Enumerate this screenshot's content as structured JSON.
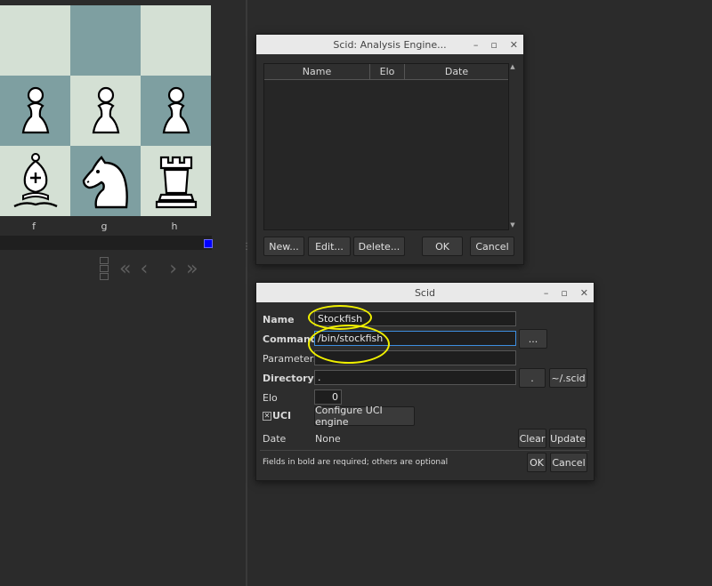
{
  "board": {
    "files": [
      "f",
      "g",
      "h"
    ],
    "pieces": {
      "pawn": "pawn-icon",
      "bishop": "bishop-icon",
      "knight": "knight-icon",
      "rook": "rook-icon"
    }
  },
  "engine_list_window": {
    "title": "Scid: Analysis Engine...",
    "columns": [
      "Name",
      "Elo",
      "Date"
    ],
    "buttons": {
      "new": "New...",
      "edit": "Edit...",
      "delete": "Delete...",
      "ok": "OK",
      "cancel": "Cancel"
    }
  },
  "engine_config_window": {
    "title": "Scid",
    "fields": {
      "name_label": "Name",
      "name_value": "Stockfish",
      "command_label": "Command",
      "command_value": "/bin/stockfish",
      "parameters_label": "Parameters",
      "parameters_value": "",
      "directory_label": "Directory",
      "directory_value": ".",
      "elo_label": "Elo",
      "elo_value": "0",
      "uci_label": "UCI",
      "date_label": "Date",
      "date_value": "None"
    },
    "buttons": {
      "browse": "...",
      "dir_dot": ".",
      "dir_home": "~/.scid",
      "configure_uci": "Configure UCI engine",
      "clear": "Clear",
      "update": "Update",
      "ok": "OK",
      "cancel": "Cancel"
    },
    "uci_checked": true,
    "hint": "Fields in bold are required; others are optional"
  },
  "colors": {
    "highlight": "#f0f000",
    "focus": "#3d8ee0",
    "board_light": "#d4e0d4",
    "board_dark": "#7e9fa1"
  }
}
